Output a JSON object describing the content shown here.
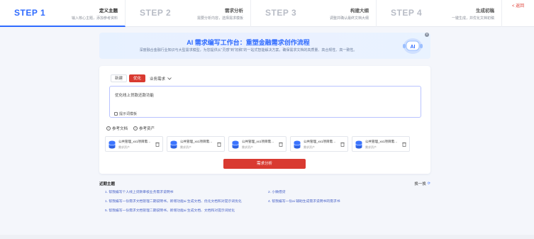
{
  "steps": [
    {
      "num": "STEP 1",
      "title": "定义主题",
      "sub": "输入核心主题，添加参考资料"
    },
    {
      "num": "STEP 2",
      "title": "需求分析",
      "sub": "需要分析内容，选择需求模板"
    },
    {
      "num": "STEP 3",
      "title": "构建大纲",
      "sub": "调整并确认最终文档大纲"
    },
    {
      "num": "STEP 4",
      "title": "生成初稿",
      "sub": "一键生成，并优化文档初稿"
    }
  ],
  "back_label": "< 返回",
  "banner": {
    "title": "AI 需求编写工作台：重塑金融需求创作流程",
    "subtitle": "深度融合金融行业知识与大型需求模型，为您提供从“灵感”到“初稿”的一站式智能解决方案，确保需求文档的高质量、高合规性、高一致性。",
    "robot_text": "AI",
    "close_icon": "close-icon"
  },
  "card": {
    "tabs": [
      "新建",
      "优化"
    ],
    "active_tab": "优化",
    "dropdown_label": "业务需求",
    "editor_text": "优化线上贷款还款功能",
    "template_label": "提示词模板",
    "refs": [
      "参考文档",
      "参考资产"
    ],
    "files": [
      {
        "name": "公共管理_xx1项目需求说明书",
        "meta": "需求资产"
      },
      {
        "name": "公共管理_xx1项目需求说明书",
        "meta": "需求资产"
      },
      {
        "name": "公共管理_xx1项目需求说明书",
        "meta": "需求资产"
      },
      {
        "name": "公共管理_xx1项目需求说明书",
        "meta": "需求资产"
      },
      {
        "name": "公共管理_xx1项目需求说明书",
        "meta": "需求资产"
      }
    ],
    "submit_label": "需求分析"
  },
  "recent": {
    "title": "近期主题",
    "swap_label": "换一换",
    "topics": [
      "1. 帮我编写个人线上贷款审核业务需求说明书",
      "2. 小微借贷",
      "1. 帮我编写一份需求文档管理二期说明书，新增功能ai 生成文档、优化文档和对提示词优化",
      "4. 帮我编写一份ai 辅助生成需求说明书的需求书",
      "5. 帮我编写一份需求文档管理二期说明书，新增功能ai 生成文档、文档和对提示词优化"
    ]
  },
  "colors": {
    "accent": "#2f6bff",
    "brand_red": "#d93a31"
  }
}
